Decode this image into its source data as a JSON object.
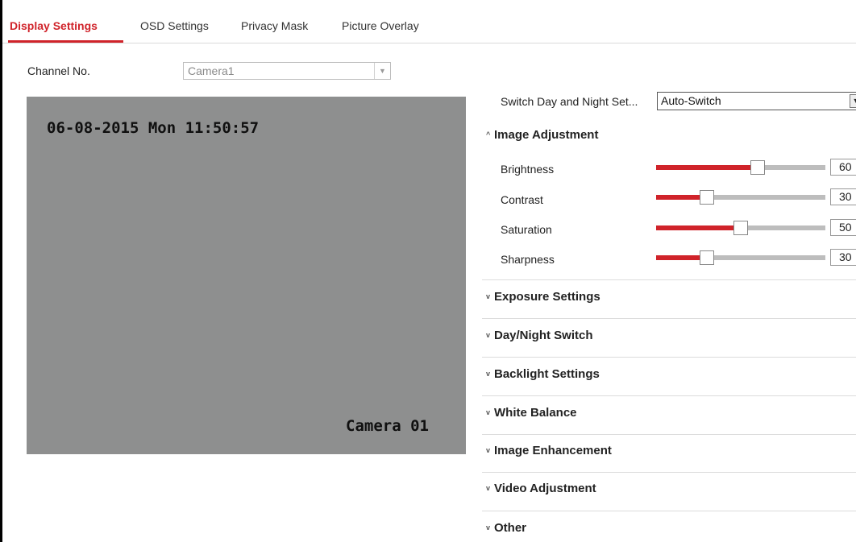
{
  "tabs": [
    {
      "label": "Display Settings",
      "active": true
    },
    {
      "label": "OSD Settings",
      "active": false
    },
    {
      "label": "Privacy Mask",
      "active": false
    },
    {
      "label": "Picture Overlay",
      "active": false
    }
  ],
  "channel": {
    "label": "Channel No.",
    "value": "Camera1"
  },
  "preview": {
    "timestamp": "06-08-2015 Mon 11:50:57",
    "camera_name": "Camera 01"
  },
  "day_night": {
    "label": "Switch Day and Night Set...",
    "value": "Auto-Switch"
  },
  "image_adjustment": {
    "title": "Image Adjustment",
    "sliders": [
      {
        "label": "Brightness",
        "value": "60",
        "fraction": 0.6
      },
      {
        "label": "Contrast",
        "value": "30",
        "fraction": 0.3
      },
      {
        "label": "Saturation",
        "value": "50",
        "fraction": 0.5
      },
      {
        "label": "Sharpness",
        "value": "30",
        "fraction": 0.3
      }
    ]
  },
  "sections": [
    "Exposure Settings",
    "Day/Night Switch",
    "Backlight Settings",
    "White Balance",
    "Image Enhancement",
    "Video Adjustment",
    "Other"
  ],
  "colors": {
    "accent": "#d0232a",
    "preview_bg": "#8e8f8f"
  }
}
